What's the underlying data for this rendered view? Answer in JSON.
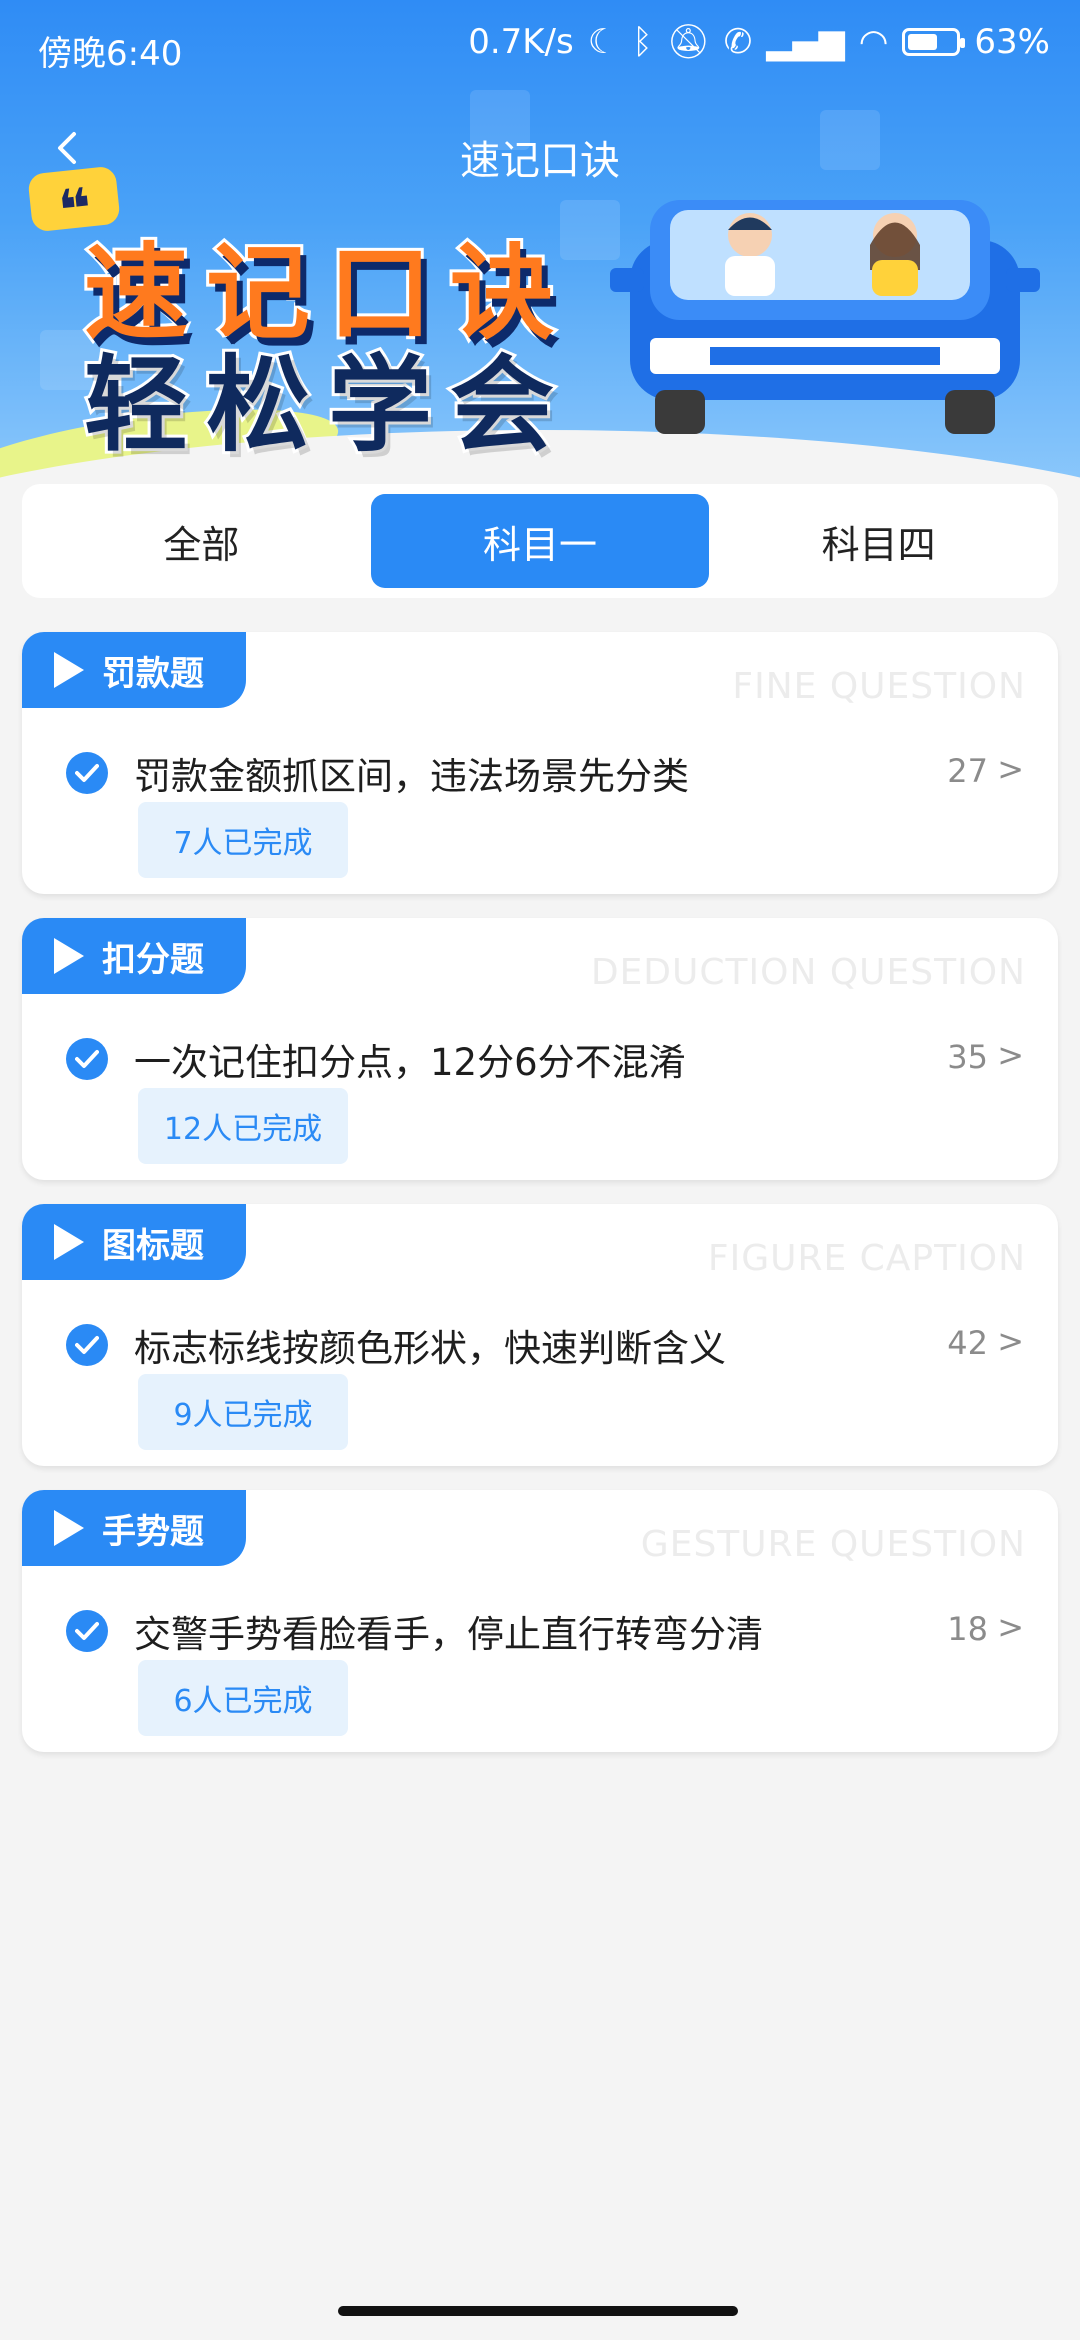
{
  "status_bar": {
    "time": "傍晚6:40",
    "network_speed": "0.7K/s",
    "battery_level": 0.63,
    "battery_text": "63%"
  },
  "header": {
    "title": "速记口诀",
    "banner_line1": "速记口诀",
    "banner_line2": "轻松学会"
  },
  "tabs": [
    "全部",
    "科目一",
    "科目四"
  ],
  "cards": [
    {
      "badge": "罚款题",
      "watermark": "FINE QUESTION",
      "text": "罚款金额抓区间，违法场景先分类",
      "count": "27",
      "arrow": ">",
      "done": "7人已完成"
    },
    {
      "badge": "扣分题",
      "watermark": "DEDUCTION QUESTION",
      "text": "一次记住扣分点，12分6分不混淆",
      "count": "35",
      "arrow": ">",
      "done": "12人已完成"
    },
    {
      "badge": "图标题",
      "watermark": "FIGURE CAPTION",
      "text": "标志标线按颜色形状，快速判断含义",
      "count": "42",
      "arrow": ">",
      "done": "9人已完成"
    },
    {
      "badge": "手势题",
      "watermark": "GESTURE QUESTION",
      "text": "交警手势看脸看手，停止直行转弯分清",
      "count": "18",
      "arrow": ">",
      "done": "6人已完成"
    }
  ]
}
